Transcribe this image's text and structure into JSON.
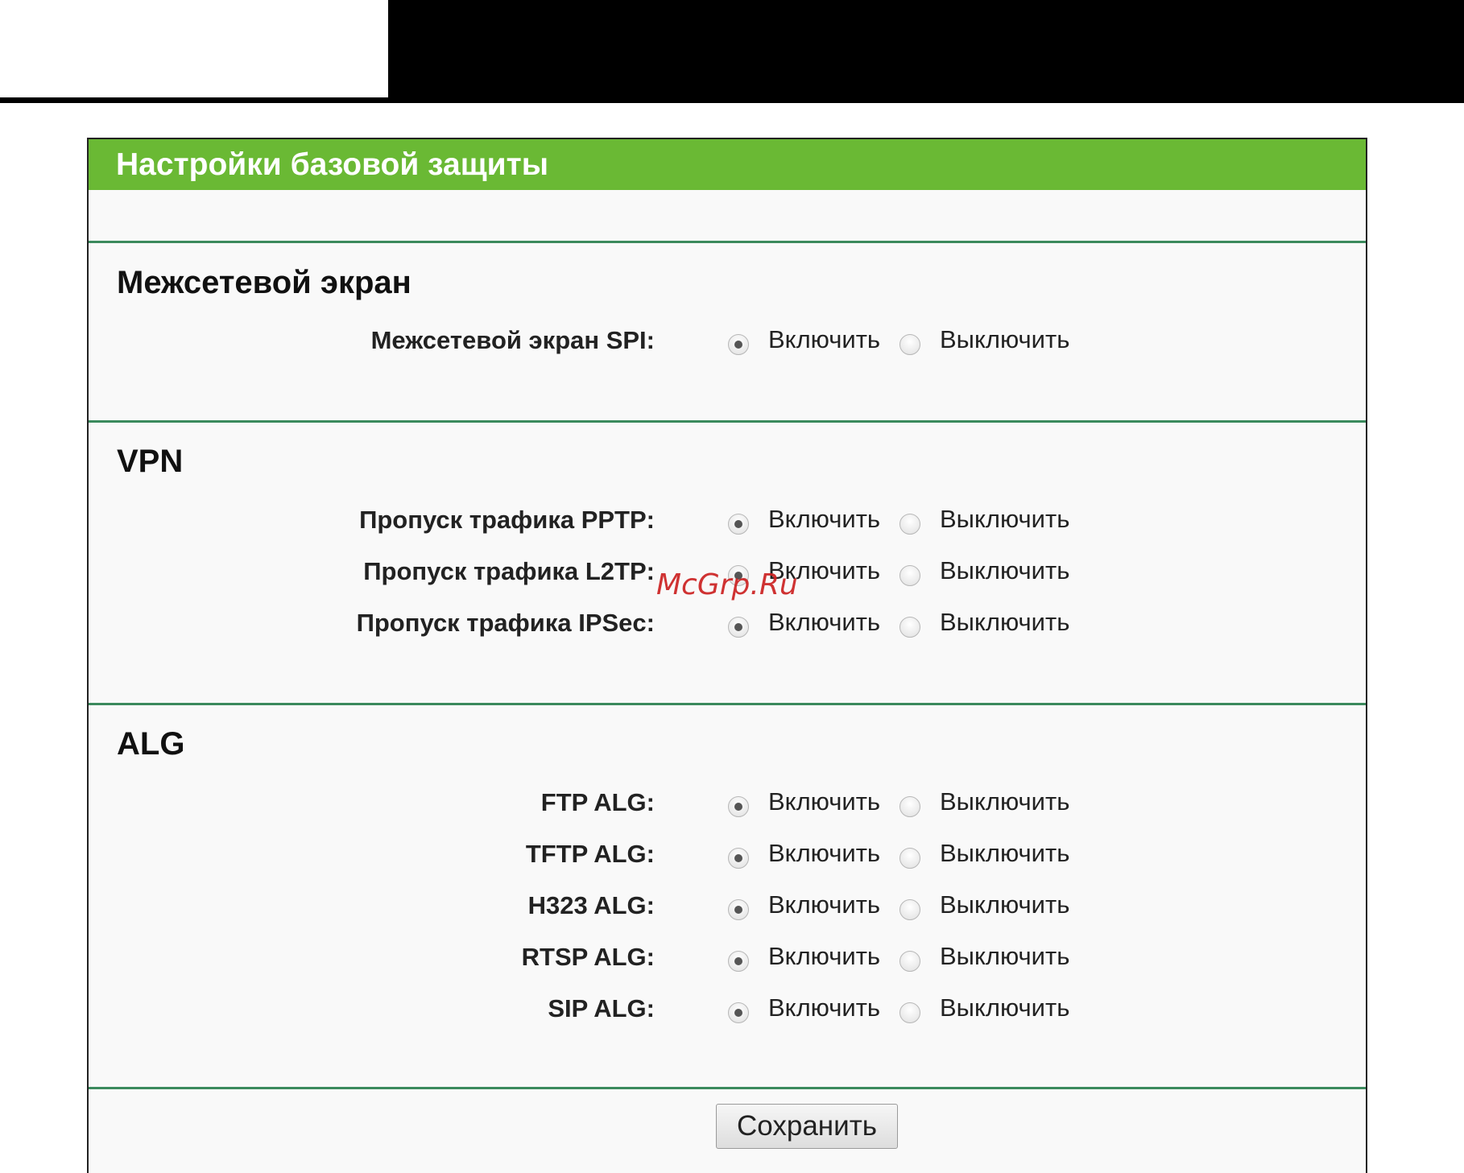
{
  "panel": {
    "title": "Настройки базовой защиты"
  },
  "sections": {
    "firewall": {
      "title": "Межсетевой экран",
      "rows": [
        {
          "label": "Межсетевой экран SPI:",
          "enable": "Включить",
          "disable": "Выключить",
          "selected": "enable"
        }
      ]
    },
    "vpn": {
      "title": "VPN",
      "rows": [
        {
          "label": "Пропуск трафика PPTP:",
          "enable": "Включить",
          "disable": "Выключить",
          "selected": "enable"
        },
        {
          "label": "Пропуск трафика L2TP:",
          "enable": "Включить",
          "disable": "Выключить",
          "selected": "enable"
        },
        {
          "label": "Пропуск трафика IPSec:",
          "enable": "Включить",
          "disable": "Выключить",
          "selected": "enable"
        }
      ]
    },
    "alg": {
      "title": "ALG",
      "rows": [
        {
          "label": "FTP ALG:",
          "enable": "Включить",
          "disable": "Выключить",
          "selected": "enable"
        },
        {
          "label": "TFTP ALG:",
          "enable": "Включить",
          "disable": "Выключить",
          "selected": "enable"
        },
        {
          "label": "H323 ALG:",
          "enable": "Включить",
          "disable": "Выключить",
          "selected": "enable"
        },
        {
          "label": "RTSP ALG:",
          "enable": "Включить",
          "disable": "Выключить",
          "selected": "enable"
        },
        {
          "label": "SIP ALG:",
          "enable": "Включить",
          "disable": "Выключить",
          "selected": "enable"
        }
      ]
    }
  },
  "buttons": {
    "save_label": "Сохранить"
  },
  "watermark": "McGrp.Ru",
  "colors": {
    "header": "#6ab934",
    "separator": "#3b8a5d",
    "watermark": "#cc2222"
  }
}
